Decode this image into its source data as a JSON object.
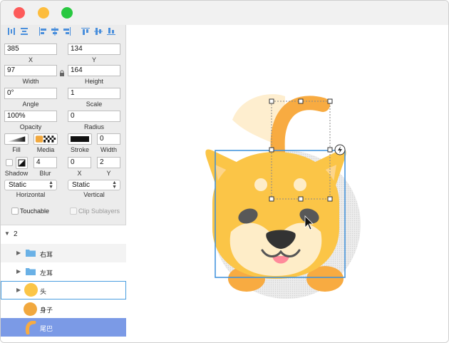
{
  "window": {
    "controls": [
      "close",
      "minimize",
      "maximize"
    ],
    "colors": {
      "close": "#fd5b5a",
      "minimize": "#fdbd3d",
      "maximize": "#28c840"
    }
  },
  "inspector": {
    "align_icons": [
      "distribute-vertical-icon",
      "distribute-horizontal-icon",
      "align-left-icon",
      "align-center-horizontal-icon",
      "align-right-icon",
      "align-top-icon",
      "align-middle-vertical-icon",
      "align-bottom-icon"
    ],
    "x": {
      "value": "385",
      "label": "X"
    },
    "y": {
      "value": "134",
      "label": "Y"
    },
    "width": {
      "value": "97",
      "label": "Width"
    },
    "height": {
      "value": "164",
      "label": "Height"
    },
    "angle": {
      "value": "0°",
      "label": "Angle"
    },
    "scale": {
      "value": "1",
      "label": "Scale"
    },
    "opacity": {
      "value": "100%",
      "label": "Opacity"
    },
    "radius": {
      "value": "0",
      "label": "Radius"
    },
    "fill_label": "Fill",
    "media_label": "Media",
    "stroke_label": "Stroke",
    "stroke_width": {
      "value": "0",
      "label": "Width"
    },
    "shadow_label": "Shadow",
    "blur": {
      "value": "4",
      "label": "Blur"
    },
    "shadow_x": {
      "value": "0",
      "label": "X"
    },
    "shadow_y": {
      "value": "2",
      "label": "Y"
    },
    "horizontal": {
      "value": "Static",
      "label": "Horizontal"
    },
    "vertical": {
      "value": "Static",
      "label": "Vertical"
    },
    "touchable_label": "Touchable",
    "clip_label": "Clip Sublayers"
  },
  "layers": {
    "group_name": "2",
    "items": [
      {
        "name": "右耳",
        "type": "folder",
        "state": "shaded"
      },
      {
        "name": "左耳",
        "type": "folder",
        "state": "normal"
      },
      {
        "name": "头",
        "type": "circle",
        "state": "hover"
      },
      {
        "name": "身子",
        "type": "circle",
        "state": "normal"
      },
      {
        "name": "尾巴",
        "type": "tail",
        "state": "selected"
      }
    ],
    "colors": {
      "selected": "#7b9ae6",
      "folder": "#6ab1e6",
      "head": "#fbc547",
      "body": "#f1a83e"
    }
  },
  "canvas": {
    "colors": {
      "head": "#fbc547",
      "muzzle": "#feedc8",
      "ear_inner": "#fdd58a",
      "tail": "#f8ab41",
      "tail_shadow": "#feeecf",
      "eyes": "#585858",
      "nose": "#333333",
      "tongue": "#ff8a9b",
      "selection": "#3a8fdb"
    }
  }
}
